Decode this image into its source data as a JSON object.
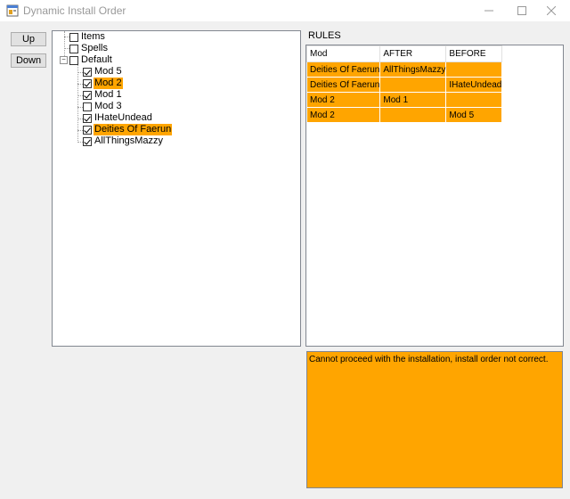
{
  "window": {
    "title": "Dynamic Install Order",
    "controls": [
      "minimize",
      "maximize",
      "close"
    ]
  },
  "buttons": {
    "up": "Up",
    "down": "Down"
  },
  "tree": {
    "nodes": [
      {
        "label": "Items",
        "checked": false,
        "level": 0,
        "selected": false
      },
      {
        "label": "Spells",
        "checked": false,
        "level": 0,
        "selected": false
      },
      {
        "label": "Default",
        "checked": false,
        "level": 0,
        "expanded": true,
        "selected": false
      },
      {
        "label": "Mod 5",
        "checked": true,
        "level": 1,
        "selected": false
      },
      {
        "label": "Mod 2",
        "checked": true,
        "level": 1,
        "selected": true
      },
      {
        "label": "Mod 1",
        "checked": true,
        "level": 1,
        "selected": false
      },
      {
        "label": "Mod 3",
        "checked": false,
        "level": 1,
        "selected": false
      },
      {
        "label": "IHateUndead",
        "checked": true,
        "level": 1,
        "selected": false
      },
      {
        "label": "Deities Of Faerun",
        "checked": true,
        "level": 1,
        "selected": true
      },
      {
        "label": "AllThingsMazzy",
        "checked": true,
        "level": 1,
        "selected": false
      }
    ]
  },
  "rules": {
    "label": "RULES",
    "columns": [
      "Mod",
      "AFTER",
      "BEFORE"
    ],
    "rows": [
      [
        "Deities Of Faerun",
        "AllThingsMazzy",
        ""
      ],
      [
        "Deities Of Faerun",
        "",
        "IHateUndead"
      ],
      [
        "Mod 2",
        "Mod 1",
        ""
      ],
      [
        "Mod 2",
        "",
        "Mod 5"
      ]
    ]
  },
  "message": "Cannot proceed with the installation, install order not correct.",
  "colors": {
    "highlight": "#ffa500",
    "window_bg": "#f0f0f0"
  }
}
